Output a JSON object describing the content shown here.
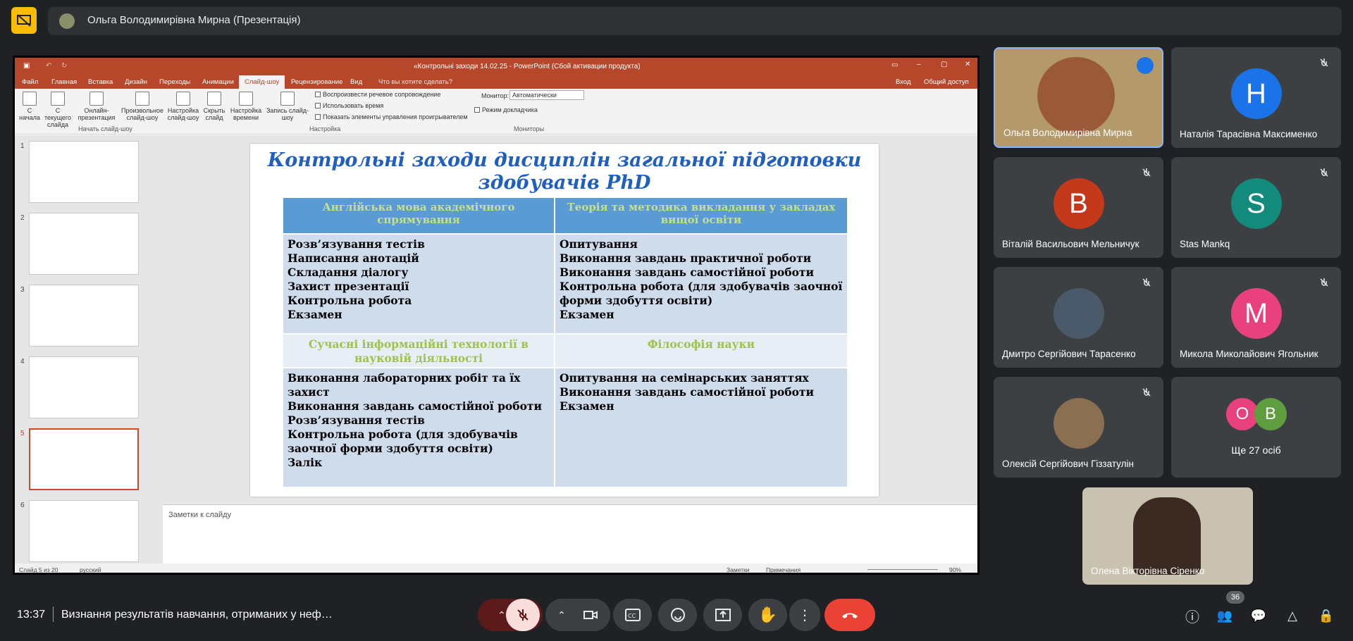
{
  "presenter_bar": {
    "title": "Ольга Володимирівна Мирна (Презентація)"
  },
  "powerpoint": {
    "window_title": "«Контрольні заходи 14.02.25 - PowerPoint (Сбой активации продукта)",
    "tabs": [
      "Файл",
      "Главная",
      "Вставка",
      "Дизайн",
      "Переходы",
      "Анимации",
      "Слайд-шоу",
      "Рецензирование",
      "Вид"
    ],
    "tell_me": "Что вы хотите сделать?",
    "login": "Вход",
    "share": "Общий доступ",
    "ribbon_buttons": [
      "С начала",
      "С текущего слайда",
      "Онлайн-презентация",
      "Произвольное слайд-шоу",
      "Настройка слайд-шоу",
      "Скрыть слайд",
      "Настройка времени",
      "Запись слайд-шоу"
    ],
    "checkboxes": [
      "Воспроизвести речевое сопровождение",
      "Использовать время",
      "Показать элементы управления проигрывателем"
    ],
    "monitor_label": "Монитор:",
    "monitor_value": "Автоматически",
    "presenter_view": "Режим докладчика",
    "groups": [
      "Начать слайд-шоу",
      "Настройка",
      "Мониторы"
    ],
    "slide_numbers": [
      "1",
      "2",
      "3",
      "4",
      "5",
      "6"
    ],
    "notes_placeholder": "Заметки к слайду",
    "status": {
      "slide": "Слайд 5 из 20",
      "lang": "русский",
      "notes": "Заметки",
      "comments": "Примечания",
      "zoom": "90%"
    }
  },
  "slide": {
    "title": "Контрольні заходи дисциплін загальної підготовки здобувачів PhD",
    "h1": "Англійська мова академічного спрямування",
    "h2": "Теорія та методика викладання у закладах вищої освіти",
    "c1": "Розв’язування тестів\nНаписання анотацій\nСкладання діалогу\nЗахист презентації\nКонтрольна робота\nЕкзамен",
    "c2": "Опитування\nВиконання завдань практичної роботи\nВиконання завдань самостійної роботи\nКонтрольна робота (для здобувачів заочної форми здобуття освіти)\nЕкзамен",
    "h3": "Сучасні інформаційні технології в науковій діяльності",
    "h4": "Філософія науки",
    "c3": "Виконання лабораторних робіт та їх захист\nВиконання завдань самостійної роботи\nРозв’язування тестів\nКонтрольна робота (для здобувачів заочної форми здобуття освіти)\nЗалік",
    "c4": "Опитування на семінарських заняттях\nВиконання завдань самостійної роботи\nЕкзамен"
  },
  "participants": [
    {
      "name": "Ольга Володимирівна Мирна",
      "kind": "video"
    },
    {
      "name": "Наталія Тарасівна Максименко",
      "initial": "Н",
      "color": "#1a73e8"
    },
    {
      "name": "Віталій Васильович Мельничук",
      "initial": "B",
      "color": "#c5391b"
    },
    {
      "name": "Stas Mankq",
      "initial": "S",
      "color": "#128b7d"
    },
    {
      "name": "Дмитро Сергійович Тарасенко",
      "kind": "photo"
    },
    {
      "name": "Микола Миколайович Ягольник",
      "initial": "M",
      "color": "#e8417b"
    },
    {
      "name": "Олексій Сергійович Гіззатулін",
      "kind": "photo"
    },
    {
      "name": "Ще 27 осіб",
      "chips": [
        "O",
        "B"
      ]
    }
  ],
  "self_view": {
    "name": "Олена Вікторівна Сіренко"
  },
  "bottom": {
    "time": "13:37",
    "meeting": "Визнання результатів навчання, отриманих у неф…",
    "people_count": "36"
  }
}
